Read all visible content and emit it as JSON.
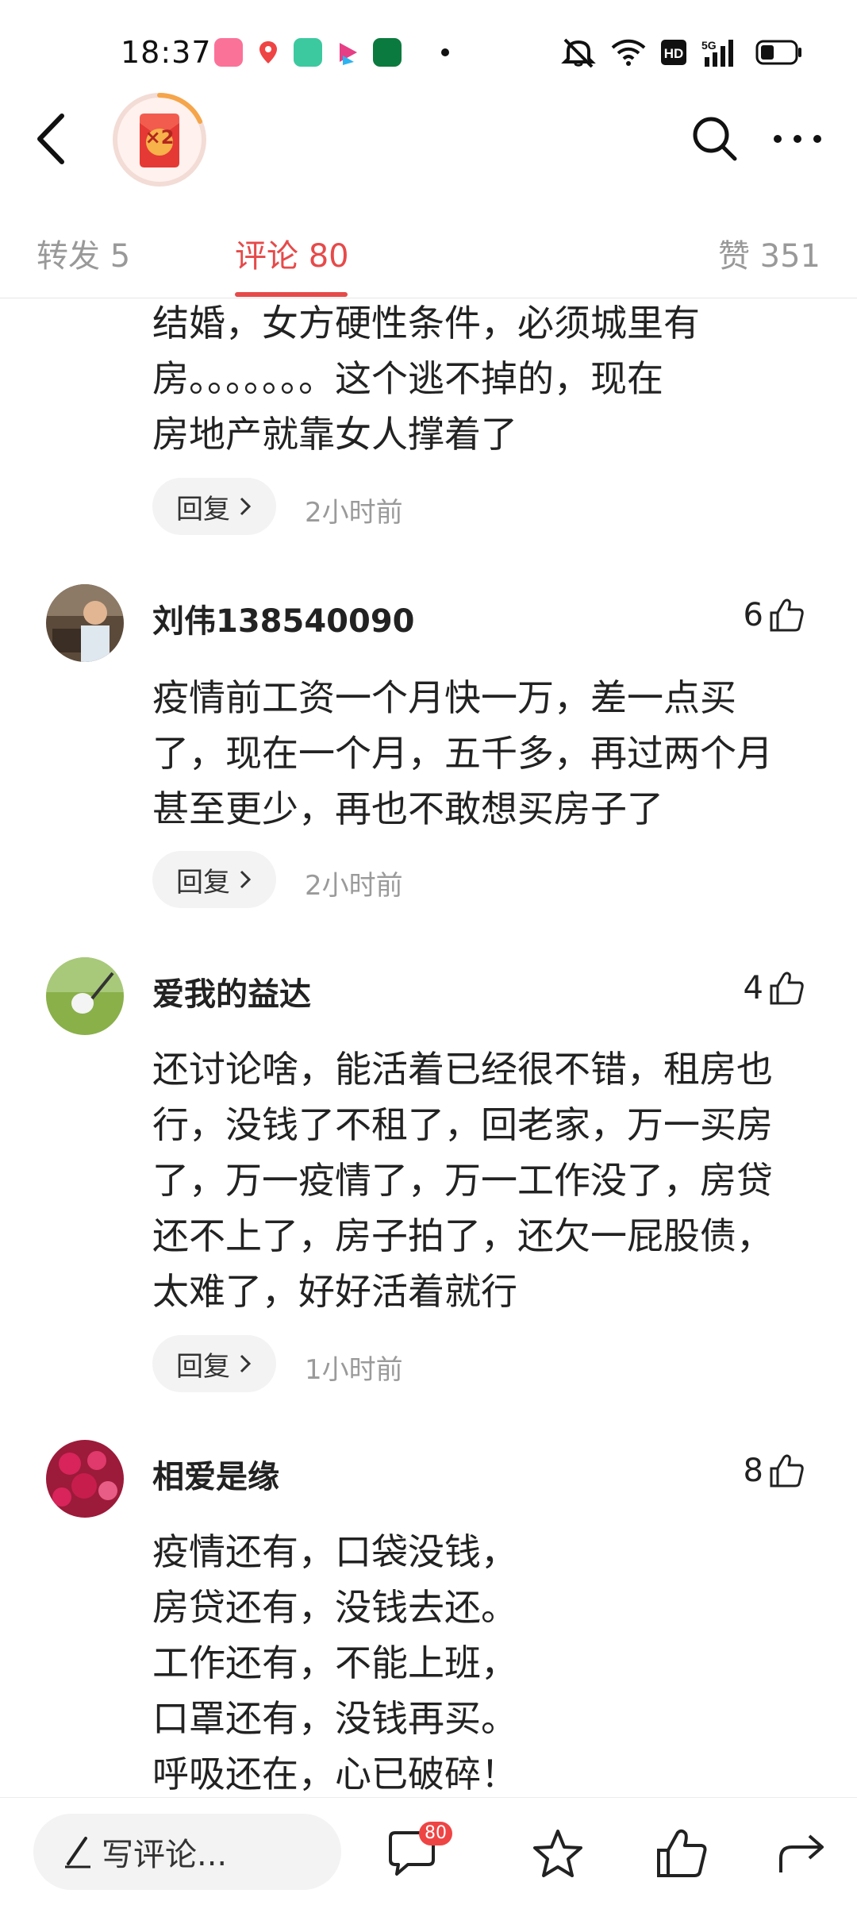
{
  "status_bar": {
    "time": "18:37",
    "app_icons": [
      "bilibili-icon",
      "map-pin-app-icon",
      "green-square-app-icon",
      "video-app-icon",
      "oppo-app-icon"
    ],
    "indicators": [
      "mute-icon",
      "wifi-icon",
      "hd-icon",
      "5g-signal-icon",
      "battery-icon"
    ]
  },
  "nav": {
    "task_badge_label": "×2"
  },
  "tabs": {
    "repost": "转发 5",
    "comments": "评论 80",
    "likes": "赞 351",
    "active": "comments",
    "accent_color": "#e64a4a"
  },
  "comments": [
    {
      "partial": true,
      "text": "结婚，女方硬性条件，必须城里有\n房。。。。。。。这个逃不掉的，现在\n房地产就靠女人撑着了",
      "reply_label": "回复",
      "time": "2小时前"
    },
    {
      "username": "刘伟138540090",
      "likes": "6",
      "text": "疫情前工资一个月快一万，差一点买\n了，现在一个月，五千多，再过两个月\n甚至更少，再也不敢想买房子了",
      "reply_label": "回复",
      "time": "2小时前"
    },
    {
      "username": "爱我的益达",
      "likes": "4",
      "text": "还讨论啥，能活着已经很不错，租房也\n行，没钱了不租了，回老家，万一买房\n了，万一疫情了，万一工作没了，房贷\n还不上了，房子拍了，还欠一屁股债，\n太难了，好好活着就行",
      "reply_label": "回复",
      "time": "1小时前"
    },
    {
      "username": "相爱是缘",
      "likes": "8",
      "text": "疫情还有，口袋没钱，\n房贷还有，没钱去还。\n工作还有，不能上班，\n口罩还有，没钱再买。\n呼吸还在，心已破碎！"
    }
  ],
  "bottom_bar": {
    "write_placeholder": "写评论...",
    "comment_count": "80"
  }
}
